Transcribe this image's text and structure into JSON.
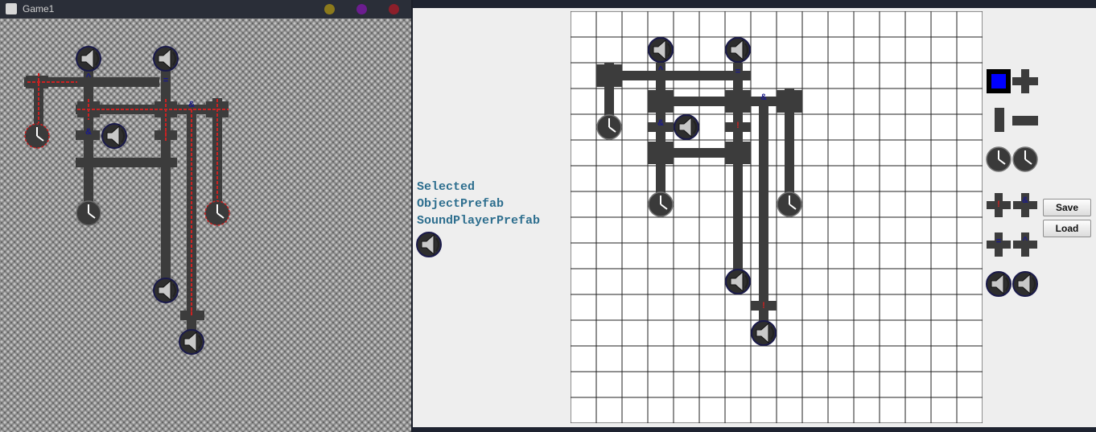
{
  "window_left": {
    "title": "Game1"
  },
  "colors": {
    "titlebar_dots": [
      "#8c7a1c",
      "#6b1d8f",
      "#8c1f2a"
    ],
    "pipe": "#3c3c3c",
    "active_wire": "#cc2222",
    "grid_bg": "#ffffff",
    "grid_line": "#222222",
    "label_text": "#2d6e8e",
    "selected_tile_fill": "#0000ff"
  },
  "editor": {
    "selected_lines": [
      "Selected",
      "ObjectPrefab",
      "SoundPlayerPrefab"
    ],
    "selected_icon": "speaker-icon",
    "grid_cols": 16,
    "grid_rows": 16,
    "palette_icons": [
      "empty-tile-icon",
      "cross-pipe-icon",
      "vertical-pipe-icon",
      "horizontal-pipe-icon",
      "clock-icon",
      "clock-icon",
      "not-gate-icon",
      "and-gate-icon",
      "equal-gate-icon",
      "hat-gate-icon",
      "speaker-icon",
      "speaker-icon"
    ]
  },
  "buttons": {
    "save": "Save",
    "load": "Load"
  },
  "gate_symbols": {
    "and": "&",
    "not": "!",
    "equal": "=",
    "hat": "^"
  }
}
